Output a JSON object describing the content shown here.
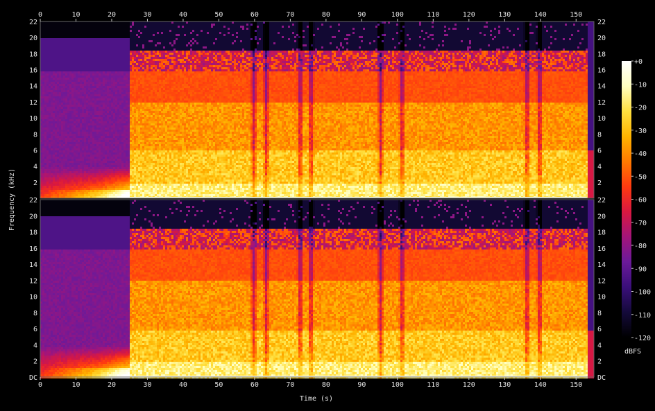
{
  "chart_data": {
    "type": "heatmap",
    "subtype": "spectrogram",
    "channels": 2,
    "xlabel": "Time (s)",
    "ylabel": "Frequency (kHz)",
    "xlim": [
      0,
      155
    ],
    "ylim_khz": [
      0,
      22
    ],
    "x_ticks": [
      0,
      10,
      20,
      30,
      40,
      50,
      60,
      70,
      80,
      90,
      100,
      110,
      120,
      130,
      140,
      150
    ],
    "y_ticks_top": [
      "2",
      "4",
      "6",
      "8",
      "10",
      "12",
      "14",
      "16",
      "18",
      "20",
      "22"
    ],
    "y_ticks_bottom": [
      "DC",
      "2",
      "4",
      "6",
      "8",
      "10",
      "12",
      "14",
      "16",
      "18",
      "20",
      "22"
    ],
    "colorbar": {
      "label": "dBFS",
      "range": [
        -120,
        0
      ],
      "ticks": [
        "+0",
        "-10",
        "-20",
        "-30",
        "-40",
        "-50",
        "-60",
        "-70",
        "-80",
        "-90",
        "-100",
        "-110",
        "-120"
      ],
      "colors": [
        "#000000",
        "#140a3a",
        "#3a0f7a",
        "#6a1a9a",
        "#a3157a",
        "#d91840",
        "#ff3a10",
        "#ff7a00",
        "#ffb400",
        "#ffe040",
        "#ffffc0",
        "#ffffff"
      ]
    },
    "description_segments": [
      {
        "start_s": 0,
        "end_s": 25,
        "cutoff_khz": 20,
        "level": "low"
      },
      {
        "start_s": 25,
        "end_s": 153,
        "cutoff_khz": 16,
        "level": "high"
      }
    ],
    "dips_s": [
      59.5,
      63,
      72.5,
      75.5,
      95,
      101,
      136,
      139.5
    ]
  }
}
